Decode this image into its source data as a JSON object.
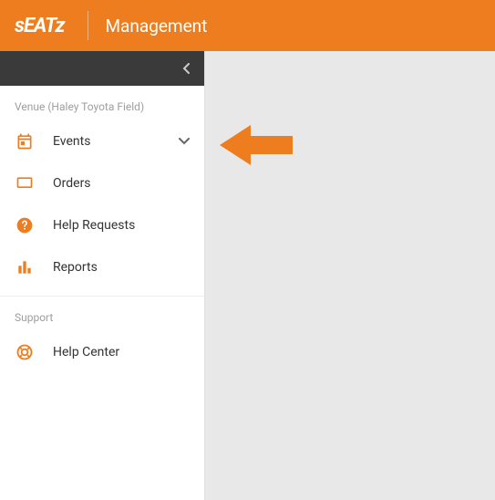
{
  "header": {
    "logo_text": "sEATz",
    "title": "Management"
  },
  "colors": {
    "brand": "#ED7D1E"
  },
  "sidebar": {
    "sections": [
      {
        "label": "Venue (Haley Toyota Field)",
        "items": [
          {
            "icon": "calendar-icon",
            "label": "Events",
            "expandable": true
          },
          {
            "icon": "monitor-icon",
            "label": "Orders",
            "expandable": false
          },
          {
            "icon": "help-icon",
            "label": "Help Requests",
            "expandable": false
          },
          {
            "icon": "reports-icon",
            "label": "Reports",
            "expandable": false
          }
        ]
      },
      {
        "label": "Support",
        "items": [
          {
            "icon": "lifebuoy-icon",
            "label": "Help Center",
            "expandable": false
          }
        ]
      }
    ]
  },
  "annotation": {
    "type": "arrow-left",
    "target": "Events"
  }
}
